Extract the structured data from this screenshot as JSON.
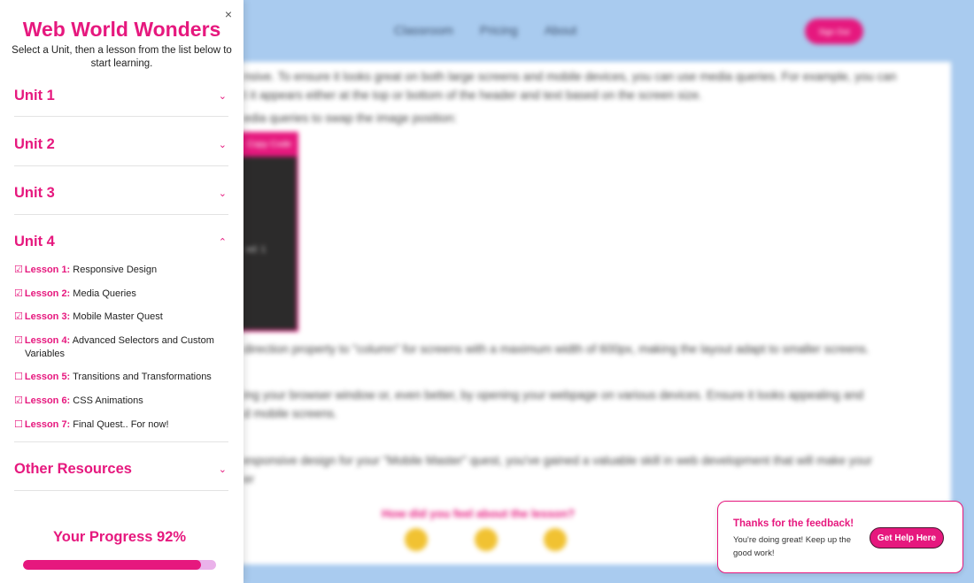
{
  "background": {
    "nav": [
      "Classroom",
      "Pricing",
      "About"
    ],
    "signup_label": "Sign Out",
    "text_lines": [
      "nsive. To ensure it looks great on both large screens and mobile devices, you can use media queries. For example, you can",
      "t it appears either at the top or bottom of the header and text based on the screen size.",
      "edia queries to swap the image position:",
      "direction property to \"column\" for screens with a maximum width of 600px, making the layout adapt to smaller screens.",
      "ing your browser window or, even better, by opening your webpage on various devices. Ensure it looks appealing and",
      "d mobile screens.",
      "esponsive design for your \"Mobile Master\" quest, you've gained a valuable skill in web development that will make your",
      "er"
    ],
    "code_button_label": "Copy Code",
    "code_fragment": "ed: 1",
    "feel_question": "How did you feel about the lesson?"
  },
  "sidebar": {
    "title": "Web World Wonders",
    "subtitle": "Select a Unit, then a lesson from the list below to start learning.",
    "close_symbol": "×",
    "units": [
      {
        "label": "Unit 1",
        "expanded": false
      },
      {
        "label": "Unit 2",
        "expanded": false
      },
      {
        "label": "Unit 3",
        "expanded": false
      },
      {
        "label": "Unit 4",
        "expanded": true
      },
      {
        "label": "Other Resources",
        "expanded": false
      }
    ],
    "lessons": [
      {
        "number": "Lesson 1:",
        "title": "Responsive Design",
        "title_cont": "",
        "checked": true
      },
      {
        "number": "Lesson 2:",
        "title": "Media Queries",
        "title_cont": "",
        "checked": true
      },
      {
        "number": "Lesson 3:",
        "title": "Mobile Master Quest",
        "title_cont": "",
        "checked": true
      },
      {
        "number": "Lesson 4:",
        "title": "Advanced Selectors and Custom",
        "title_cont": "Variables",
        "checked": true
      },
      {
        "number": "Lesson 5:",
        "title": "Transitions and Transformations",
        "title_cont": "",
        "checked": false
      },
      {
        "number": "Lesson 6:",
        "title": "CSS Animations",
        "title_cont": "",
        "checked": true
      },
      {
        "number": "Lesson 7:",
        "title": "Final Quest.. For now!",
        "title_cont": "",
        "checked": false
      }
    ],
    "progress": {
      "label": "Your Progress 92%",
      "value": 0.92
    }
  },
  "toast": {
    "title": "Thanks for the feedback!",
    "message": "You're doing great! Keep up the good work!",
    "button_label": "Get Help Here"
  },
  "colors": {
    "accent": "#e6187e",
    "background": "#a9cbef",
    "progress_track": "#eab2ea"
  }
}
